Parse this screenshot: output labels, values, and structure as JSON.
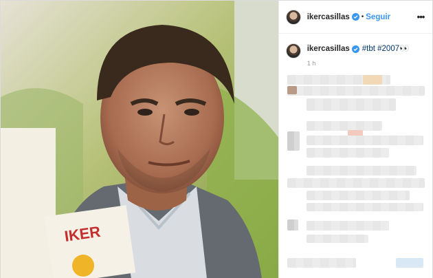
{
  "header": {
    "username": "ikercasillas",
    "separator": "•",
    "follow_label": "Seguir",
    "more_icon": "ellipsis-icon"
  },
  "caption": {
    "username": "ikercasillas",
    "hashtags": "#tbt #2007",
    "emoji": "👀",
    "time": "1 h"
  },
  "media": {
    "book_text": "IKER"
  },
  "colors": {
    "link_blue": "#3897f0",
    "hashtag_blue": "#003569",
    "verified_blue": "#3897f0",
    "border": "#dbdbdb"
  }
}
